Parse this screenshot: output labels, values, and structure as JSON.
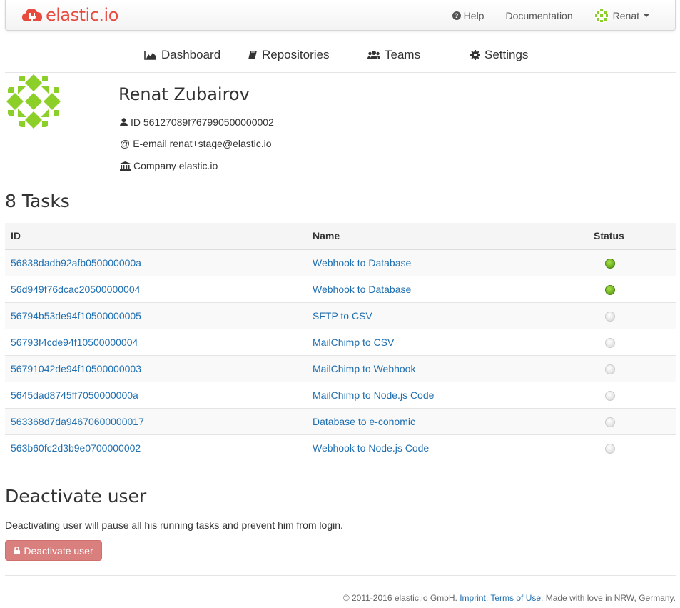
{
  "colors": {
    "brand": "#e84a3e",
    "link": "#1f6fb0",
    "status_active": "#7cc42a",
    "status_inactive": "#dddddd",
    "danger_button": "#d9807f"
  },
  "navbar": {
    "brand_label": "elastic.io",
    "help_label": "Help",
    "docs_label": "Documentation",
    "user_label": "Renat"
  },
  "section_nav": {
    "dashboard": "Dashboard",
    "repositories": "Repositories",
    "teams": "Teams",
    "settings": "Settings"
  },
  "profile": {
    "name": "Renat Zubairov",
    "id_text": "ID 56127089f767990500000002",
    "email_text": "E-email renat+stage@elastic.io",
    "company_text": "Company elastic.io"
  },
  "tasks": {
    "title": "8 Tasks",
    "headers": {
      "id": "ID",
      "name": "Name",
      "status": "Status"
    },
    "rows": [
      {
        "id": "56838dadb92afb050000000a",
        "name": "Webhook to Database",
        "status": "active"
      },
      {
        "id": "56d949f76dcac20500000004",
        "name": "Webhook to Database",
        "status": "active"
      },
      {
        "id": "56794b53de94f10500000005",
        "name": "SFTP to CSV",
        "status": "inactive"
      },
      {
        "id": "56793f4cde94f10500000004",
        "name": "MailChimp to CSV",
        "status": "inactive"
      },
      {
        "id": "56791042de94f10500000003",
        "name": "MailChimp to Webhook",
        "status": "inactive"
      },
      {
        "id": "5645dad8745ff7050000000a",
        "name": "MailChimp to Node.js Code",
        "status": "inactive"
      },
      {
        "id": "563368d7da94670600000017",
        "name": "Database to e-conomic",
        "status": "inactive"
      },
      {
        "id": "563b60fc2d3b9e0700000002",
        "name": "Webhook to Node.js Code",
        "status": "inactive"
      }
    ]
  },
  "deactivate": {
    "title": "Deactivate user",
    "description": "Deactivating user will pause all his running tasks and prevent him from login.",
    "button_label": "Deactivate user"
  },
  "footer": {
    "copyright": "© 2011-2016 elastic.io GmbH.",
    "imprint": "Imprint",
    "separator": ",",
    "terms": "Terms of Use",
    "tagline": ". Made with love in NRW, Germany."
  }
}
